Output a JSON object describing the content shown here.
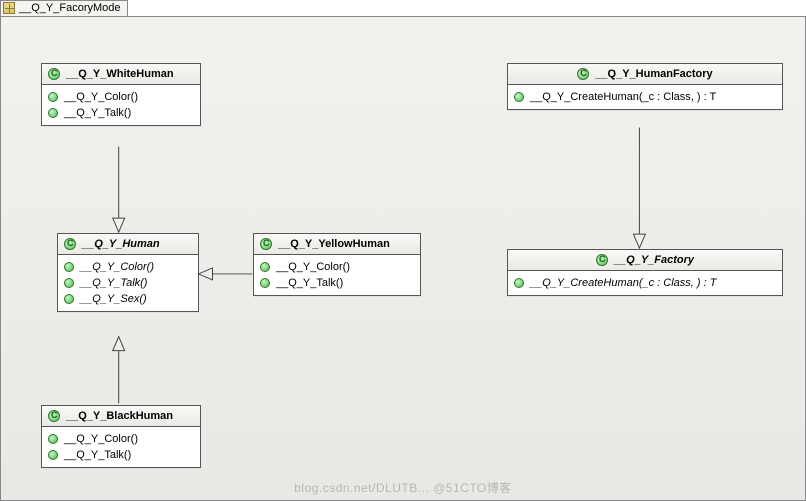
{
  "tab": {
    "title": "__Q_Y_FacoryMode"
  },
  "classes": {
    "whiteHuman": {
      "name": "__Q_Y_WhiteHuman",
      "methods": [
        "__Q_Y_Color()",
        "__Q_Y_Talk()"
      ]
    },
    "human": {
      "name": "__Q_Y_Human",
      "methods": [
        "__Q_Y_Color()",
        "__Q_Y_Talk()",
        "__Q_Y_Sex()"
      ]
    },
    "yellowHuman": {
      "name": "__Q_Y_YellowHuman",
      "methods": [
        "__Q_Y_Color()",
        "__Q_Y_Talk()"
      ]
    },
    "blackHuman": {
      "name": "__Q_Y_BlackHuman",
      "methods": [
        "__Q_Y_Color()",
        "__Q_Y_Talk()"
      ]
    },
    "humanFactory": {
      "name": "__Q_Y_HumanFactory",
      "methods": [
        "__Q_Y_CreateHuman(_c : Class, ) : T"
      ]
    },
    "factory": {
      "name": "__Q_Y_Factory",
      "methods": [
        "__Q_Y_CreateHuman(_c : Class, ) : T"
      ]
    }
  },
  "watermark": "blog.csdn.net/DLUTB... @51CTO博客"
}
